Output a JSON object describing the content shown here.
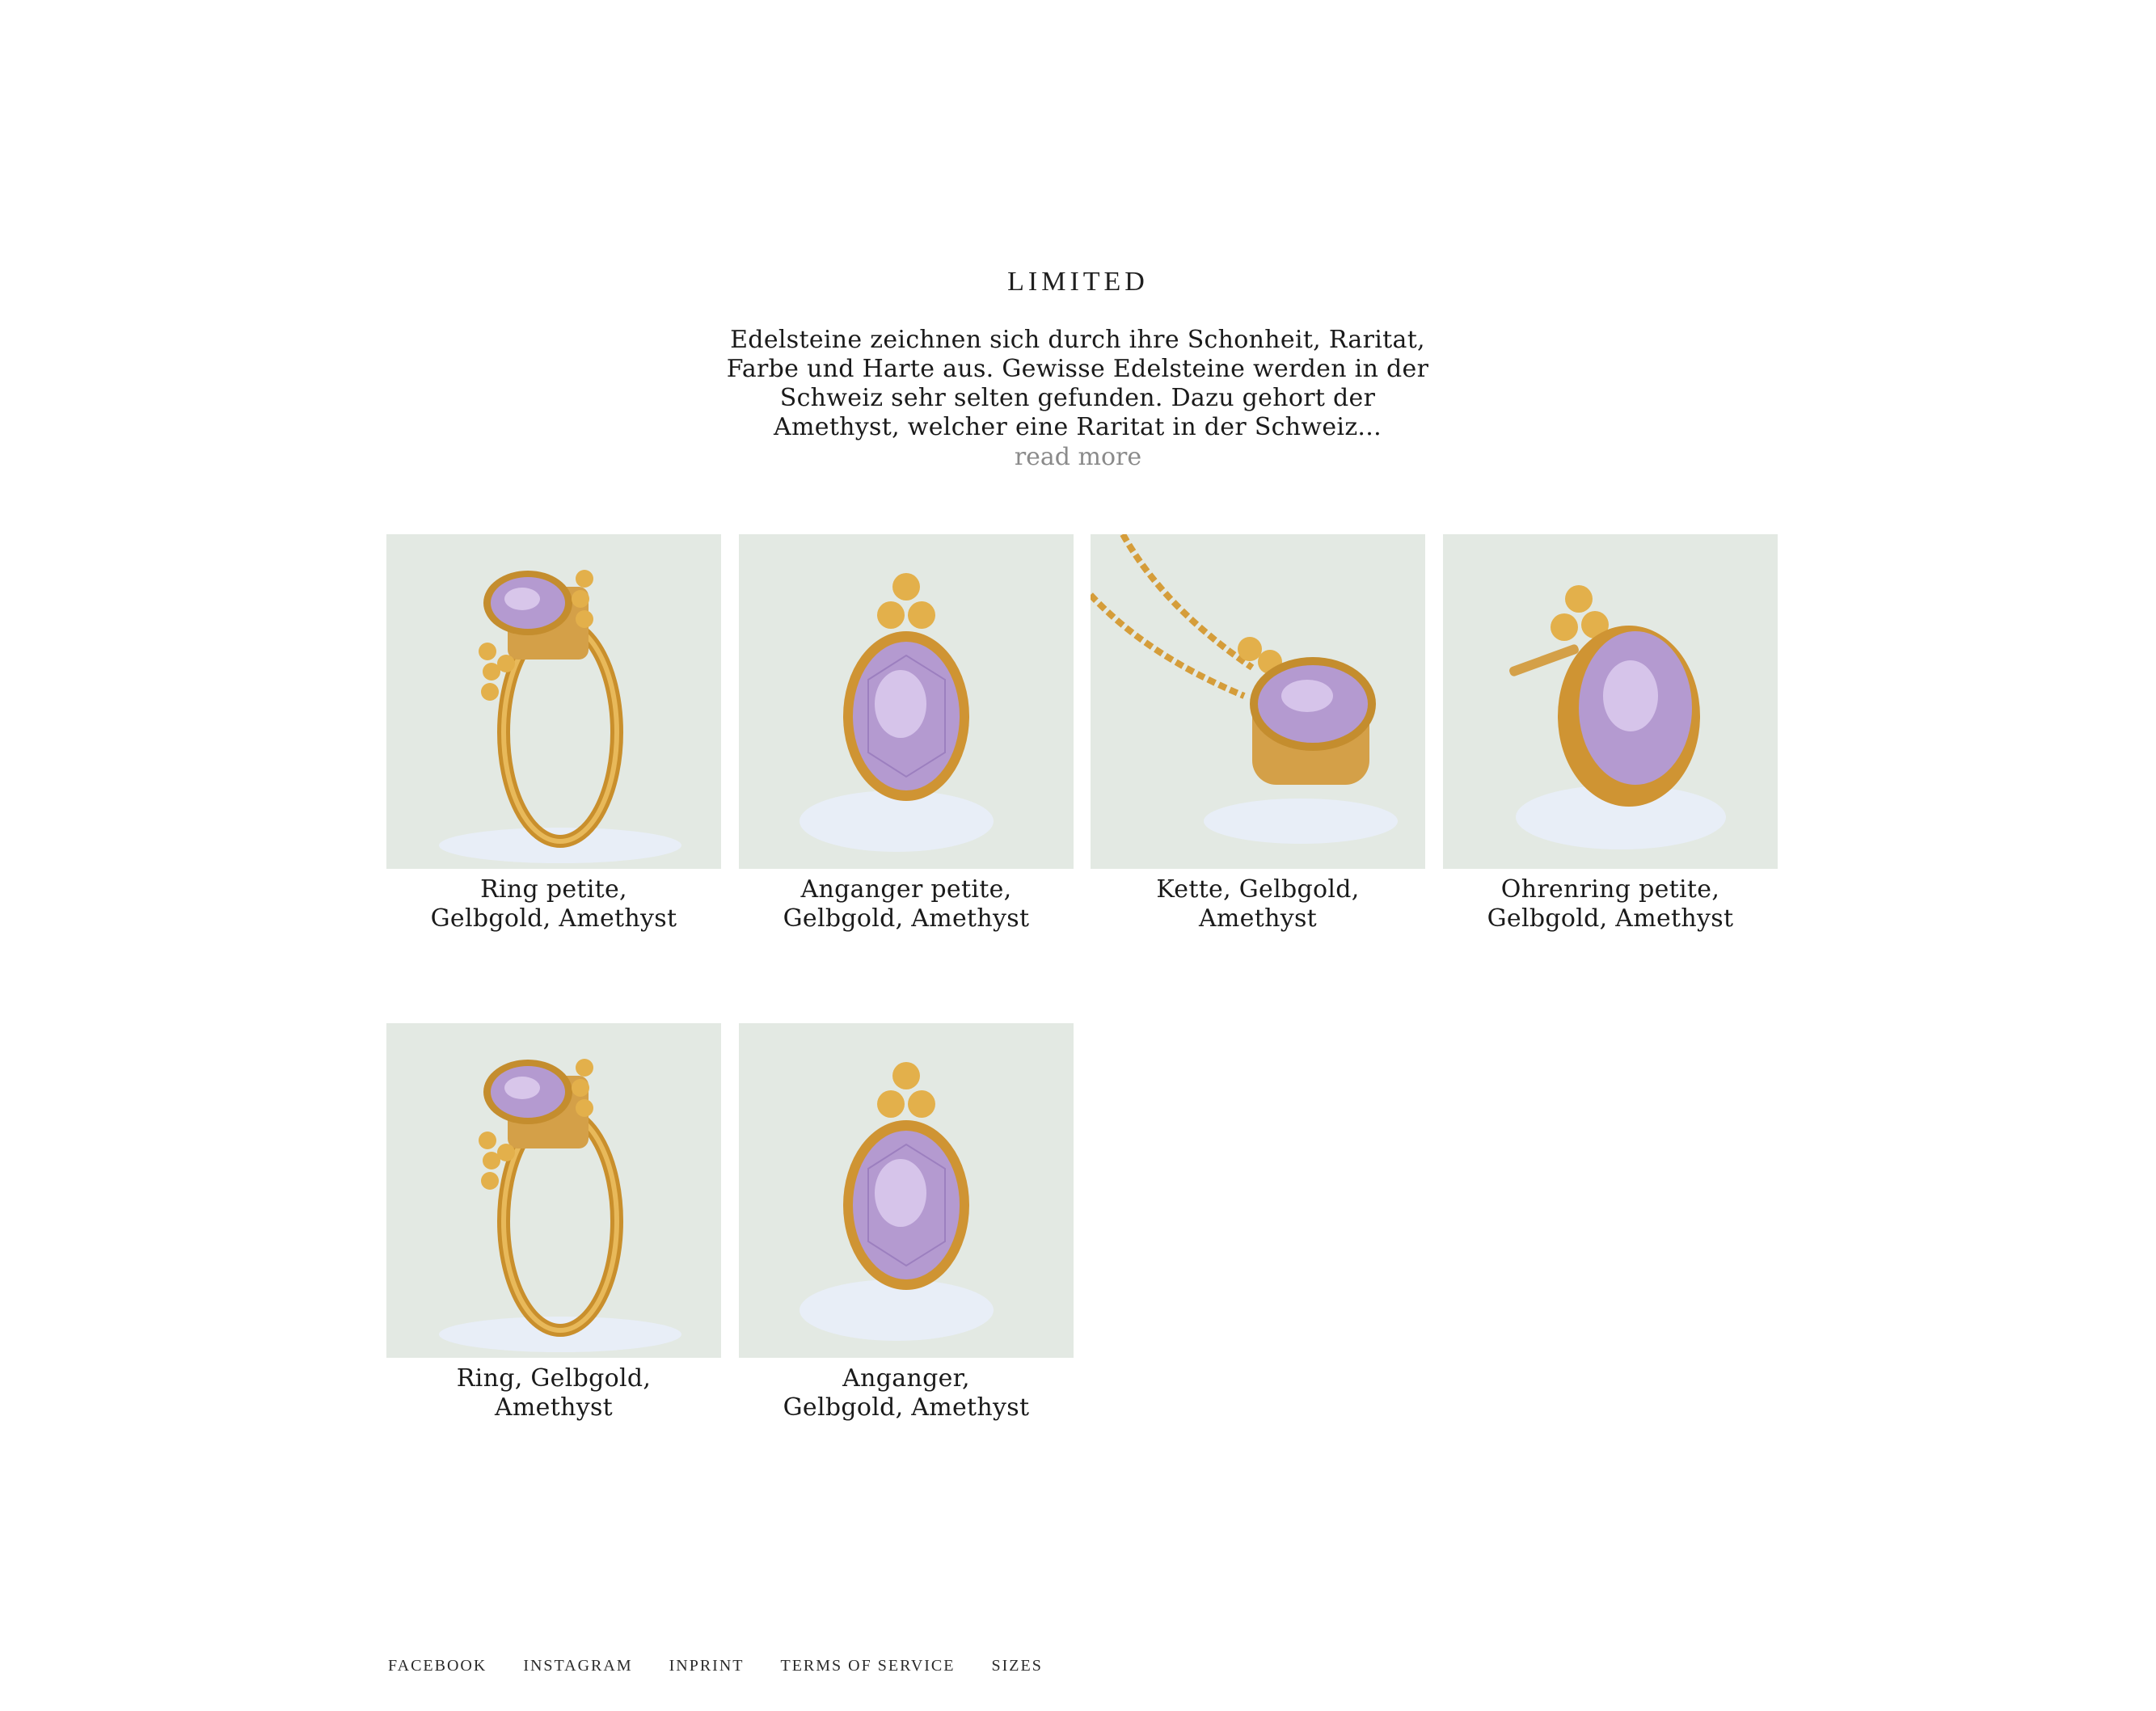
{
  "page": {
    "title": "LIMITED",
    "intro": "Edelsteine zeichnen sich durch ihre Schonheit, Raritat, Farbe und Harte aus. Gewisse Edelsteine werden in der Schweiz sehr selten gefunden. Dazu gehort der Amethyst, welcher eine Raritat in der Schweiz...",
    "read_more": "read more"
  },
  "products": [
    {
      "line1": "Ring petite,",
      "line2": "Gelbgold,  Amethyst",
      "image": "ring-icon"
    },
    {
      "line1": "Anganger petite,",
      "line2": "Gelbgold,  Amethyst",
      "image": "pendant-icon"
    },
    {
      "line1": "Kette,  Gelbgold,",
      "line2": "Amethyst",
      "image": "necklace-icon"
    },
    {
      "line1": "Ohrenring petite,",
      "line2": "Gelbgold,  Amethyst",
      "image": "earring-icon"
    },
    {
      "line1": "Ring,  Gelbgold,",
      "line2": "Amethyst",
      "image": "ring-icon"
    },
    {
      "line1": "Anganger,",
      "line2": "Gelbgold,  Amethyst",
      "image": "pendant-icon"
    }
  ],
  "footer": {
    "links": [
      "FACEBOOK",
      "INSTAGRAM",
      "INPRINT",
      "TERMS OF SERVICE",
      "SIZES"
    ]
  },
  "colors": {
    "thumb_bg": "#e3e9e3",
    "gold": "#d9a441",
    "amethyst": "#b49ad0",
    "read_more": "#8a8a8a"
  }
}
